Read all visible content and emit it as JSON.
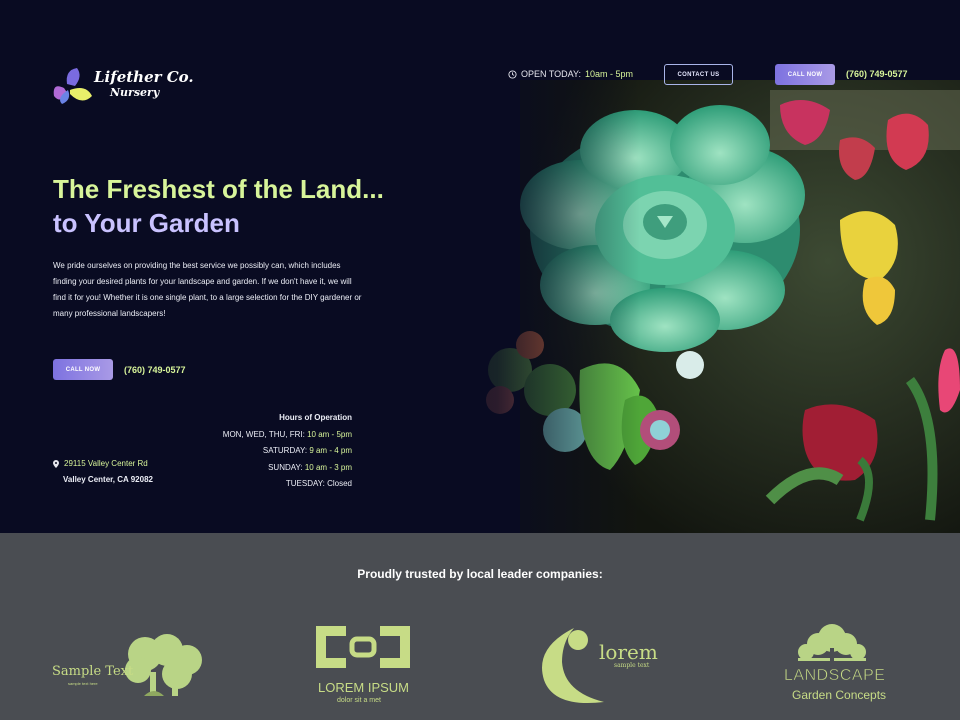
{
  "brand": {
    "name": "Lifether Co.",
    "sub": "Nursery"
  },
  "header": {
    "open_label": "OPEN TODAY:",
    "open_hours": "10am - 5pm",
    "contact_label": "CONTACT US",
    "call_label": "CALL NOW",
    "phone": "(760) 749-0577"
  },
  "hero": {
    "headline_1": "The Freshest of the Land...",
    "headline_2": "to Your Garden",
    "intro": "We pride ourselves on providing the best service we possibly can, which includes finding your desired plants for your landscape and garden. If we don't have it, we will find it for you! Whether it is one single plant, to a large selection for the DIY gardener or many professional landscapers!",
    "call_label": "CALL NOW",
    "phone": "(760) 749-0577"
  },
  "hours": {
    "title": "Hours of Operation",
    "rows": [
      {
        "day": "MON, WED, THU, FRI:",
        "time": "10 am - 5pm"
      },
      {
        "day": "SATURDAY:",
        "time": "9 am - 4 pm"
      },
      {
        "day": "SUNDAY:",
        "time": "10 am - 3 pm"
      },
      {
        "day": "TUESDAY:",
        "time": "Closed"
      }
    ]
  },
  "address": {
    "street": "29115 Valley Center Rd",
    "city": "Valley Center, CA 92082"
  },
  "trusted": {
    "title": "Proudly trusted by local leader companies:",
    "logos": [
      {
        "text": "Sample Text",
        "sub": "sample text here"
      },
      {
        "text": "LOREM IPSUM",
        "sub": "dolor sit a met"
      },
      {
        "text": "lorem",
        "sub": "sample text"
      },
      {
        "text": "LANDSCAPE",
        "sub": "Garden Concepts"
      }
    ]
  },
  "colors": {
    "accent_green": "#d8f59a",
    "accent_purple": "#c9c2ff",
    "hero_bg": "#090b22",
    "band_bg": "#4a4d52"
  }
}
